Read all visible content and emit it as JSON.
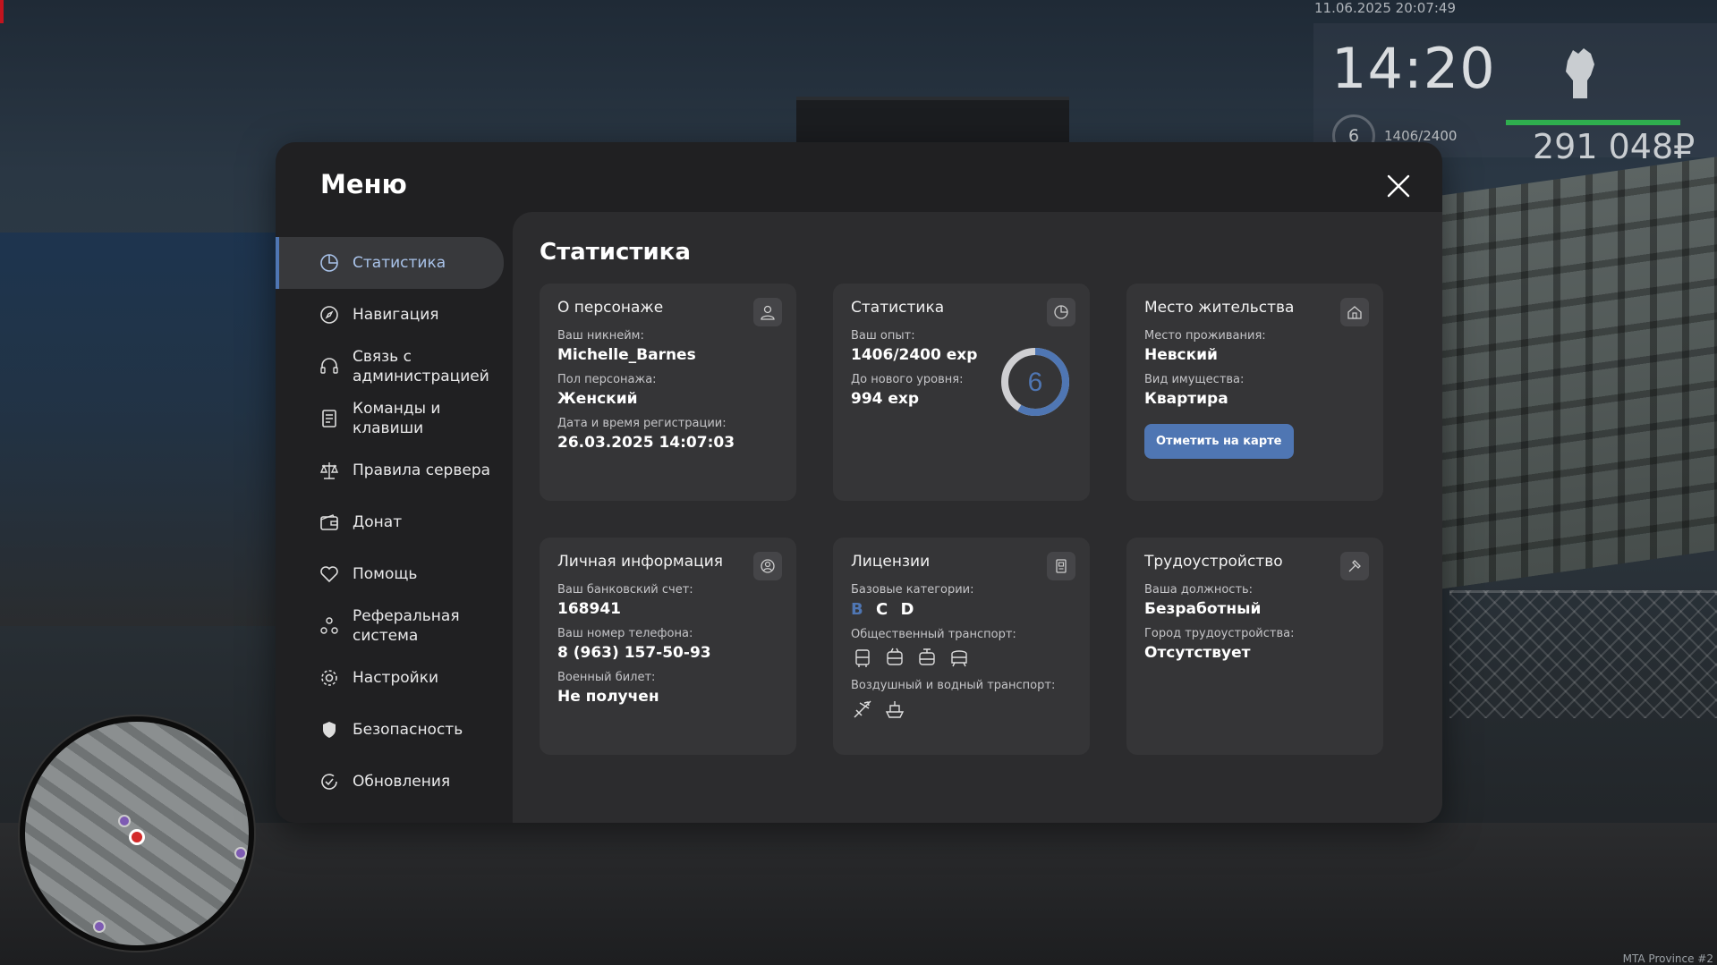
{
  "hud": {
    "datetime": "11.06.2025 20:07:49",
    "time": "14:20",
    "level": "6",
    "exp": "1406/2400",
    "money": "291 048₽"
  },
  "watermark": "MTA Province #2",
  "menu": {
    "title": "Меню",
    "sidebar": [
      {
        "label": "Статистика",
        "icon": "pie-chart-icon",
        "active": true
      },
      {
        "label": "Навигация",
        "icon": "compass-icon"
      },
      {
        "label": "Связь с администрацией",
        "icon": "headset-icon"
      },
      {
        "label": "Команды и клавиши",
        "icon": "document-icon"
      },
      {
        "label": "Правила сервера",
        "icon": "scales-icon"
      },
      {
        "label": "Донат",
        "icon": "wallet-icon"
      },
      {
        "label": "Помощь",
        "icon": "heart-hand-icon"
      },
      {
        "label": "Реферальная система",
        "icon": "people-icon"
      },
      {
        "label": "Настройки",
        "icon": "gear-icon"
      },
      {
        "label": "Безопасность",
        "icon": "shield-icon"
      },
      {
        "label": "Обновления",
        "icon": "refresh-check-icon"
      }
    ],
    "content_title": "Статистика",
    "cards": {
      "character": {
        "title": "О персонаже",
        "nickname_label": "Ваш никнейм:",
        "nickname": "Michelle_Barnes",
        "gender_label": "Пол персонажа:",
        "gender": "Женский",
        "reg_label": "Дата и время регистрации:",
        "reg": "26.03.2025 14:07:03"
      },
      "stats": {
        "title": "Статистика",
        "exp_label": "Ваш опыт:",
        "exp": "1406/2400 exp",
        "next_label": "До нового уровня:",
        "next": "994 exp",
        "level": "6",
        "progress": 0.586
      },
      "residence": {
        "title": "Место жительства",
        "place_label": "Место проживания:",
        "place": "Невский",
        "type_label": "Вид имущества:",
        "type": "Квартира",
        "button": "Отметить на карте"
      },
      "personal": {
        "title": "Личная информация",
        "bank_label": "Ваш банковский счет:",
        "bank": "168941",
        "phone_label": "Ваш номер телефона:",
        "phone": "8 (963) 157-50-93",
        "military_label": "Военный билет:",
        "military": "Не получен"
      },
      "licenses": {
        "title": "Лицензии",
        "base_label": "Базовые категории:",
        "categories": [
          "B",
          "C",
          "D"
        ],
        "public_label": "Общественный транспорт:",
        "air_label": "Воздушный и водный транспорт:"
      },
      "employment": {
        "title": "Трудоустройство",
        "position_label": "Ваша должность:",
        "position": "Безработный",
        "city_label": "Город трудоустройства:",
        "city": "Отсутствует"
      }
    }
  },
  "colors": {
    "accent": "#4f76b3",
    "money_bar": "#2fae4e"
  }
}
